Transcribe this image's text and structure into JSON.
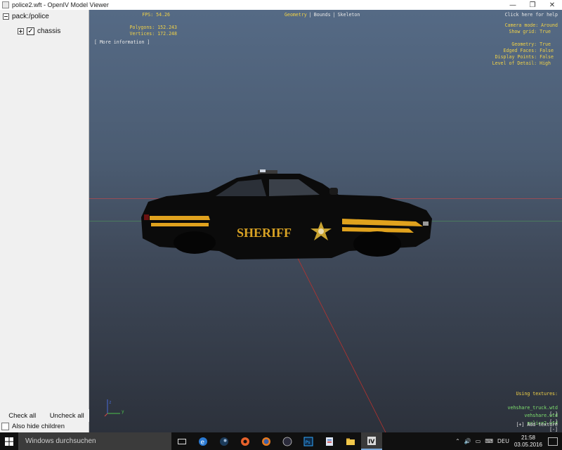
{
  "window": {
    "title": "police2.wft - OpenIV Model Viewer",
    "minimize": "—",
    "maximize": "❐",
    "close": "✕"
  },
  "tree": {
    "root_label": "pack:/police",
    "child_label": "chassis"
  },
  "sidebar": {
    "check_all": "Check all",
    "uncheck_all": "Uncheck all",
    "also_hide_children": "Also hide children"
  },
  "hud": {
    "fps": "FPS: 54.26",
    "polygons": "Polygons: 152.243",
    "vertices": "Vertices: 172.248",
    "more_info": "[ More information ]",
    "tab_geometry": "Geometry",
    "tab_bounds": "Bounds",
    "tab_skeleton": "Skeleton",
    "tab_sep": "|",
    "help": "Click here for help",
    "camera_mode": "Camera mode: Around",
    "show_grid": "Show grid: True",
    "geometry": "Geometry: True",
    "edged_faces": "Edged Faces: False",
    "display_points": "Display Points: False",
    "level_of_detail": "Level of Detail: High",
    "using_textures": "Using textures:",
    "textures": [
      {
        "name": "vehshare_truck.wtd",
        "btn": "[-]"
      },
      {
        "name": "vehshare.wtd",
        "btn": "[-]"
      },
      {
        "name": "police2.wtd",
        "btn": "[-]"
      }
    ],
    "add_texture": "[+] Add texture",
    "car_text": "SHERIFF",
    "axis_y": "y",
    "axis_z": "z"
  },
  "taskbar": {
    "search_placeholder": "Windows durchsuchen",
    "language": "DEU",
    "time": "21:58",
    "date": "03.05.2016"
  },
  "colors": {
    "hud_yellow": "#f1d247",
    "hud_green": "#7ee06e",
    "car_body": "#0b0b0b",
    "car_stripe": "#e0a21e"
  }
}
